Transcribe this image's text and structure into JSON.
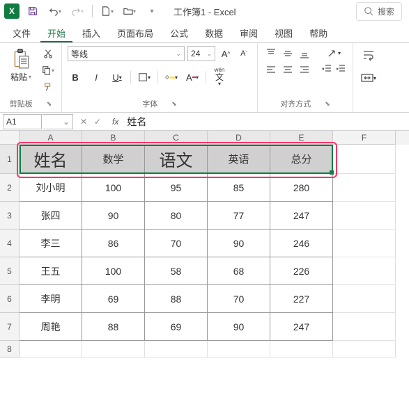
{
  "window": {
    "title": "工作簿1 - Excel"
  },
  "search": {
    "placeholder": "搜索"
  },
  "tabs": {
    "file": "文件",
    "home": "开始",
    "insert": "插入",
    "layout": "页面布局",
    "formulas": "公式",
    "data": "数据",
    "review": "审阅",
    "view": "视图",
    "help": "帮助"
  },
  "ribbon": {
    "clipboard": {
      "paste": "粘贴",
      "label": "剪贴板"
    },
    "font": {
      "name": "等线",
      "size": "24",
      "label": "字体",
      "wen": "wén"
    },
    "align": {
      "label": "对齐方式"
    }
  },
  "formula_bar": {
    "cell_ref": "A1",
    "fx": "fx",
    "value": "姓名"
  },
  "sheet": {
    "columns": [
      "A",
      "B",
      "C",
      "D",
      "E",
      "F"
    ],
    "rows": [
      "1",
      "2",
      "3",
      "4",
      "5",
      "6",
      "7",
      "8"
    ],
    "header": {
      "name": "姓名",
      "math": "数学",
      "chinese": "语文",
      "english": "英语",
      "total": "总分"
    },
    "data": [
      {
        "name": "刘小明",
        "math": "100",
        "chinese": "95",
        "english": "85",
        "total": "280"
      },
      {
        "name": "张四",
        "math": "90",
        "chinese": "80",
        "english": "77",
        "total": "247"
      },
      {
        "name": "李三",
        "math": "86",
        "chinese": "70",
        "english": "90",
        "total": "246"
      },
      {
        "name": "王五",
        "math": "100",
        "chinese": "58",
        "english": "68",
        "total": "226"
      },
      {
        "name": "李明",
        "math": "69",
        "chinese": "88",
        "english": "70",
        "total": "227"
      },
      {
        "name": "周艳",
        "math": "88",
        "chinese": "69",
        "english": "90",
        "total": "247"
      }
    ]
  }
}
